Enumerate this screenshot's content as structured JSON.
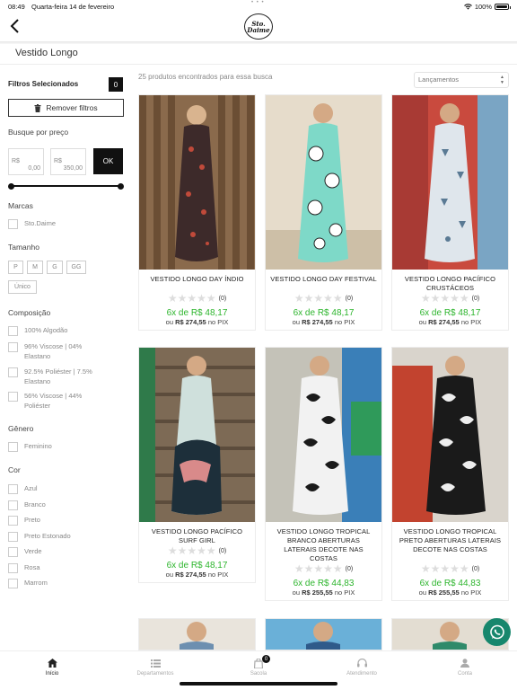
{
  "status_bar": {
    "time": "08:49",
    "date": "Quarta-feira 14 de fevereiro",
    "battery": "100%"
  },
  "header": {
    "logo_line1": "Sto.",
    "logo_line2": "Daime"
  },
  "page": {
    "title": "Vestido Longo"
  },
  "filters": {
    "selected_label": "Filtros Selecionados",
    "selected_count": "0",
    "remove_label": "Remover filtros",
    "price": {
      "title": "Busque por preço",
      "min_currency": "R$",
      "min_value": "0,00",
      "max_currency": "R$",
      "max_value": "350,00",
      "ok_label": "OK",
      "range_min_fraction": 0,
      "range_max_fraction": 1
    },
    "brands": {
      "title": "Marcas",
      "options": [
        "Sto.Daime"
      ]
    },
    "sizes": {
      "title": "Tamanho",
      "options": [
        "P",
        "M",
        "G",
        "GG",
        "Único"
      ]
    },
    "composition": {
      "title": "Composição",
      "options": [
        "100% Algodão",
        "96% Viscose | 04% Elastano",
        "92.5% Poliéster | 7.5% Elastano",
        "56% Viscose | 44% Poliéster"
      ]
    },
    "gender": {
      "title": "Gênero",
      "options": [
        "Feminino"
      ]
    },
    "color": {
      "title": "Cor",
      "options": [
        "Azul",
        "Branco",
        "Preto",
        "Preto Estonado",
        "Verde",
        "Rosa",
        "Marrom"
      ]
    }
  },
  "results": {
    "count_text": "25 produtos encontrados para essa busca",
    "sort_selected": "Lançamentos"
  },
  "products": [
    {
      "name": "VESTIDO LONGO DAY ÍNDIO",
      "rating": 0,
      "reviews": "(0)",
      "installments": "6x de R$ 48,17",
      "pix_prefix": "ou",
      "pix_price": "R$ 274,55",
      "pix_suffix": "no PIX"
    },
    {
      "name": "VESTIDO LONGO DAY FESTIVAL",
      "rating": 0,
      "reviews": "(0)",
      "installments": "6x de R$ 48,17",
      "pix_prefix": "ou",
      "pix_price": "R$ 274,55",
      "pix_suffix": "no PIX"
    },
    {
      "name": "VESTIDO LONGO PACÍFICO CRUSTÁCEOS",
      "rating": 0,
      "reviews": "(0)",
      "installments": "6x de R$ 48,17",
      "pix_prefix": "ou",
      "pix_price": "R$ 274,55",
      "pix_suffix": "no PIX"
    },
    {
      "name": "VESTIDO LONGO PACÍFICO SURF GIRL",
      "rating": 0,
      "reviews": "(0)",
      "installments": "6x de R$ 48,17",
      "pix_prefix": "ou",
      "pix_price": "R$ 274,55",
      "pix_suffix": "no PIX"
    },
    {
      "name": "VESTIDO LONGO TROPICAL BRANCO ABERTURAS LATERAIS DECOTE NAS COSTAS",
      "rating": 0,
      "reviews": "(0)",
      "installments": "6x de R$ 44,83",
      "pix_prefix": "ou",
      "pix_price": "R$ 255,55",
      "pix_suffix": "no PIX"
    },
    {
      "name": "VESTIDO LONGO TROPICAL PRETO ABERTURAS LATERAIS DECOTE NAS COSTAS",
      "rating": 0,
      "reviews": "(0)",
      "installments": "6x de R$ 44,83",
      "pix_prefix": "ou",
      "pix_price": "R$ 255,55",
      "pix_suffix": "no PIX"
    }
  ],
  "bottom_nav": [
    {
      "label": "Início",
      "icon": "home-icon",
      "active": true
    },
    {
      "label": "Departamentos",
      "icon": "list-icon",
      "active": false
    },
    {
      "label": "Sacola",
      "icon": "bag-icon",
      "active": false,
      "badge": "0"
    },
    {
      "label": "Atendimento",
      "icon": "headset-icon",
      "active": false
    },
    {
      "label": "Conta",
      "icon": "user-icon",
      "active": false
    }
  ],
  "colors": {
    "accent_green": "#2db52d",
    "whatsapp": "#17876d",
    "dark": "#111111"
  }
}
